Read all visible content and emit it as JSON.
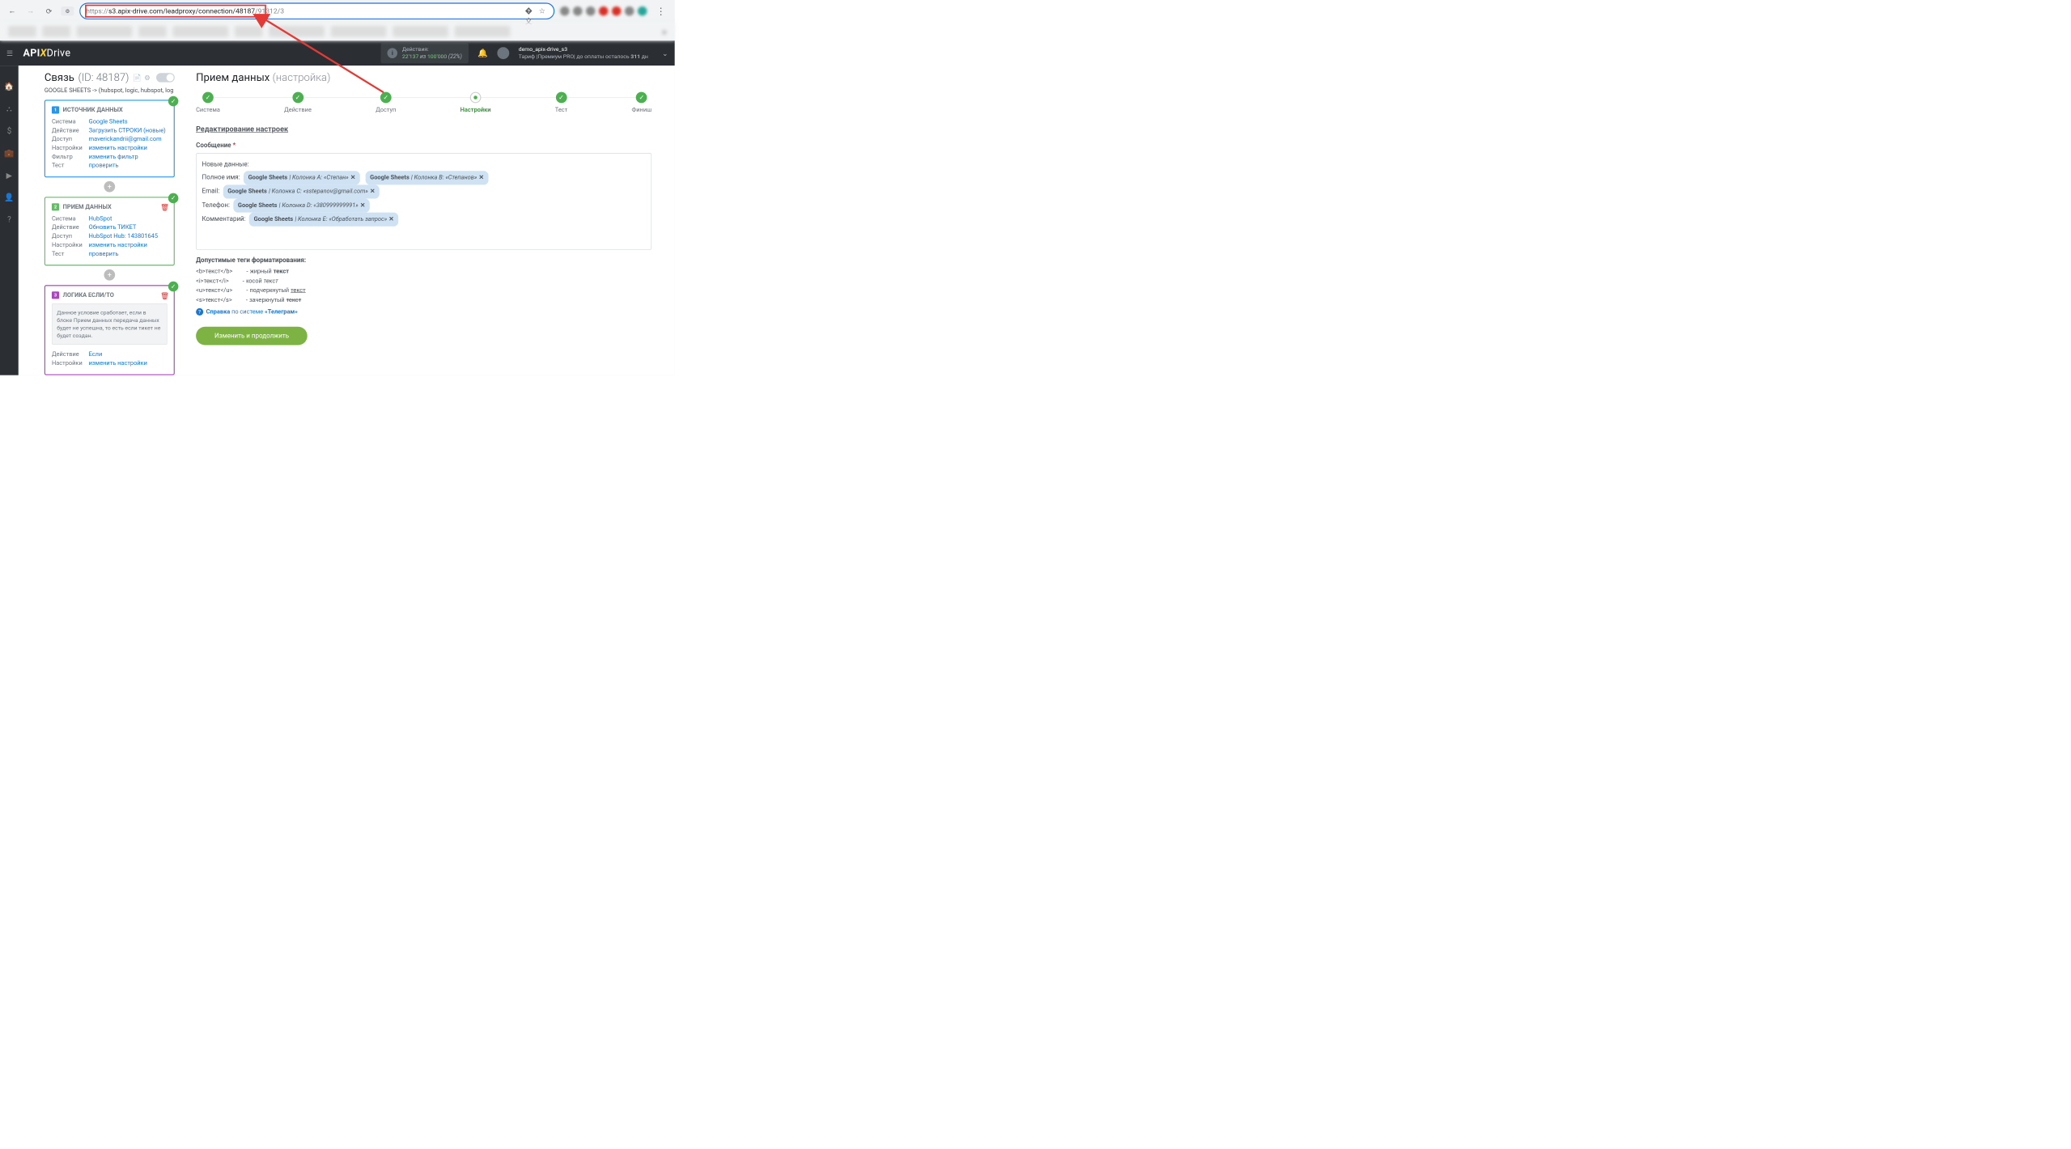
{
  "browser": {
    "url_prefix": "https://",
    "url_main": "s3.apix-drive.com/leadproxy/connection/48187",
    "url_suffix": "/91312/3"
  },
  "header": {
    "logo_api": "API",
    "logo_x": "X",
    "logo_drive": "Drive",
    "actions_label": "Действия:",
    "actions_used": "22'137",
    "actions_of": " из ",
    "actions_total": "100'000",
    "actions_pct": " (22%)",
    "username": "demo_apix-drive_s3",
    "plan_prefix": "Тариф |Премиум PRO| до оплаты осталось ",
    "plan_days": "311",
    "plan_suffix": " дн"
  },
  "connection": {
    "title": "Связь",
    "id_label": "(ID: 48187)",
    "subtitle": "GOOGLE SHEETS -> (hubspot, logic, hubspot, log"
  },
  "card1": {
    "title": "ИСТОЧНИК ДАННЫХ",
    "rows": [
      {
        "k": "Система",
        "v": "Google Sheets"
      },
      {
        "k": "Действие",
        "v": "Загрузить СТРОКИ (новые)"
      },
      {
        "k": "Доступ",
        "v": "maverickandrii@gmail.com"
      },
      {
        "k": "Настройки",
        "v": "изменить настройки"
      },
      {
        "k": "Фильтр",
        "v": "изменить фильтр"
      },
      {
        "k": "Тест",
        "v": "проверить"
      }
    ]
  },
  "card2": {
    "title": "ПРИЕМ ДАННЫХ",
    "rows": [
      {
        "k": "Система",
        "v": "HubSpot"
      },
      {
        "k": "Действие",
        "v": "Обновить ТИКЕТ"
      },
      {
        "k": "Доступ",
        "v": "HubSpot Hub: 143801645"
      },
      {
        "k": "Настройки",
        "v": "изменить настройки"
      },
      {
        "k": "Тест",
        "v": "проверить"
      }
    ]
  },
  "card3": {
    "title": "ЛОГИКА ЕСЛИ/ТО",
    "note": "Данное условие сработает, если в блоке Прием данных передача данных будет не успешна, то есть если тикет не будет создан.",
    "rows": [
      {
        "k": "Действие",
        "v": "Если"
      },
      {
        "k": "Настройки",
        "v": "изменить настройки"
      }
    ]
  },
  "main": {
    "title": "Прием данных ",
    "title_sub": "(настройка)",
    "steps": [
      "Система",
      "Действие",
      "Доступ",
      "Настройки",
      "Тест",
      "Финиш"
    ],
    "section": "Редактирование настроек",
    "field_label": "Сообщение",
    "msg": {
      "line1": "Новые данные:",
      "l2_label": "Полное имя:",
      "l2_t1_src": "Google Sheets",
      "l2_t1_rest": " | Колонка A: «Степан»",
      "l2_t2_src": "Google Sheets",
      "l2_t2_rest": " | Колонка B: «Степанов»",
      "l3_label": "Email:",
      "l3_t1_src": "Google Sheets",
      "l3_t1_rest": " | Колонка C: «sstepanov@gmail.com»",
      "l4_label": "Телефон:",
      "l4_t1_src": "Google Sheets",
      "l4_t1_rest": " | Колонка D: «380999999991»",
      "l5_label": "Комментарий:",
      "l5_t1_src": "Google Sheets",
      "l5_t1_rest": " | Колонка E: «Обработать запрос»"
    },
    "format_title": "Допустимые теги форматирования:",
    "formats": [
      {
        "tag": "<b>текст</b>",
        "desc": "- жирный ",
        "ex": "текст",
        "style": "b"
      },
      {
        "tag": "<i>текст</i>",
        "desc": "- косой ",
        "ex": "текст",
        "style": "i"
      },
      {
        "tag": "<u>текст</u>",
        "desc": "- подчеркнутый ",
        "ex": "текст",
        "style": "u"
      },
      {
        "tag": "<s>текст</s>",
        "desc": "- зачеркнутый ",
        "ex": "текст",
        "style": "s"
      }
    ],
    "help_prefix": "Справка",
    "help_mid": " по системе ",
    "help_system": "«Телеграм»",
    "submit": "Изменить и продолжить"
  }
}
